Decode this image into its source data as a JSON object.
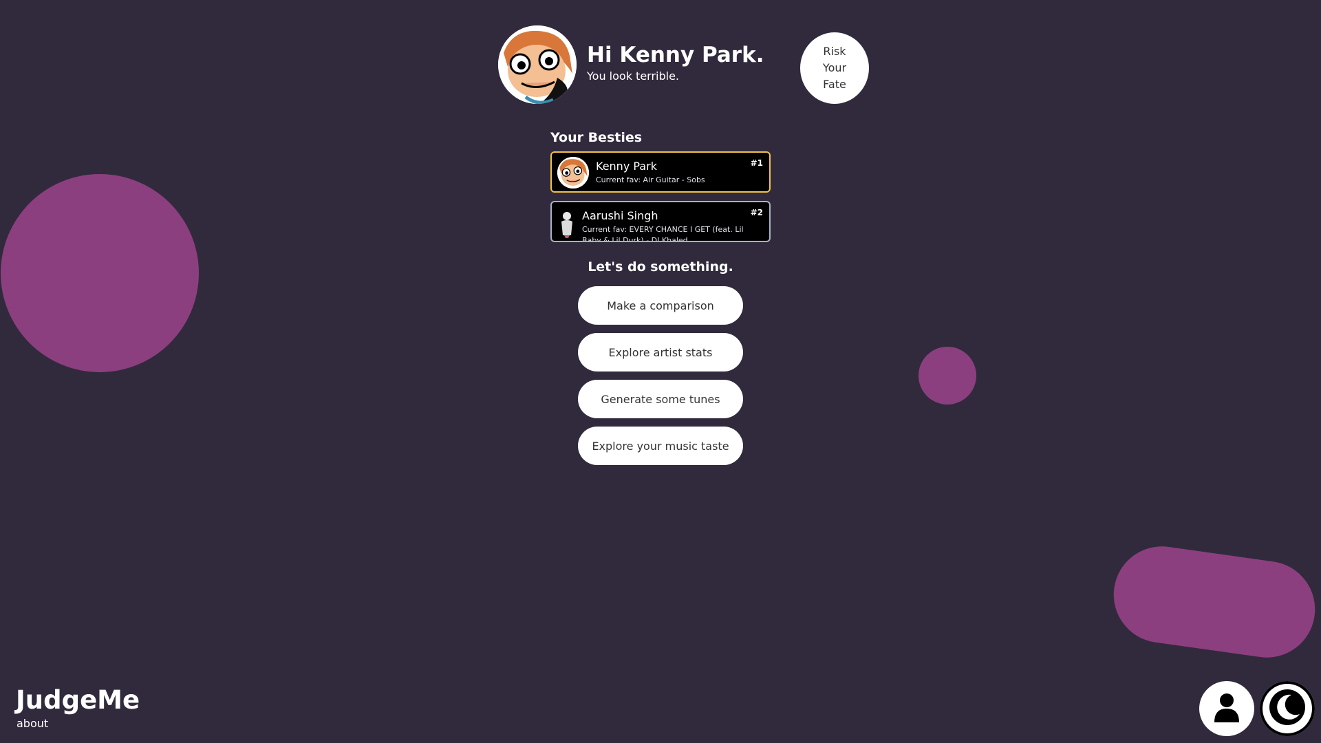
{
  "header": {
    "greeting": "Hi Kenny Park.",
    "subtitle": "You look terrible.",
    "fate_button": "Risk\nYour\nFate"
  },
  "besties": {
    "title": "Your Besties",
    "items": [
      {
        "name": "Kenny Park",
        "fav": "Current fav: Air Guitar - Sobs",
        "rank": "#1",
        "border": "#f2c24a"
      },
      {
        "name": "Aarushi Singh",
        "fav": "Current fav: EVERY CHANCE I GET (feat. Lil Baby & Lil Durk) - DJ Khaled",
        "rank": "#2",
        "border": "#aab2c4"
      }
    ]
  },
  "actions": {
    "title": "Let's do something.",
    "buttons": [
      "Make a comparison",
      "Explore artist stats",
      "Generate some tunes",
      "Explore your music taste"
    ]
  },
  "footer": {
    "brand": "JudgeMe",
    "about": "about"
  },
  "icons": {
    "profile": "user-icon",
    "theme": "moon-icon"
  },
  "colors": {
    "background": "#312a3d",
    "blob": "#8c3f7e",
    "rank1_border": "#f2c24a",
    "rank2_border": "#aab2c4"
  }
}
